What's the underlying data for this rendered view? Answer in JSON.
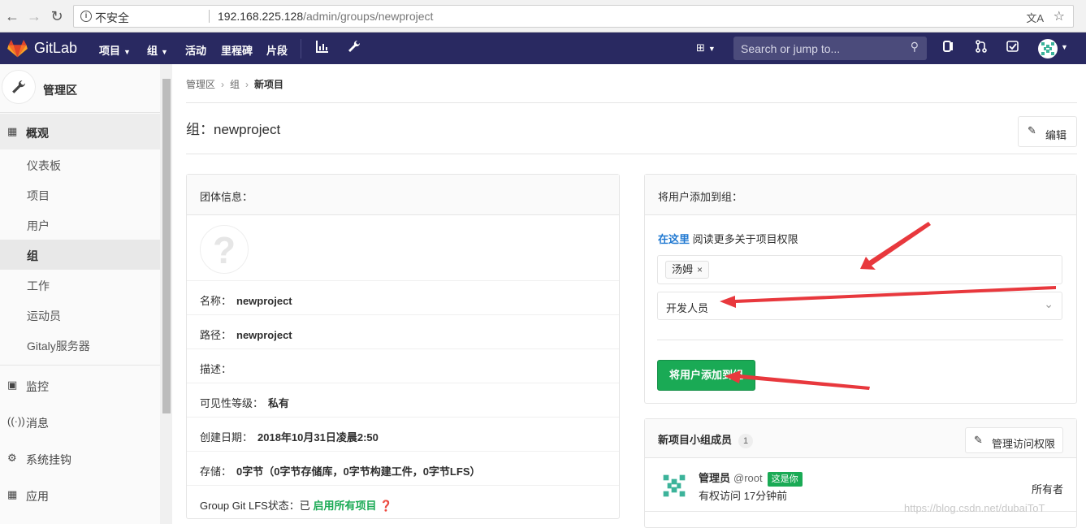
{
  "browser": {
    "insecure_label": "不安全",
    "url_host": "192.168.225.128",
    "url_path": "/admin/groups/newproject"
  },
  "navbar": {
    "brand": "GitLab",
    "menu": [
      "项目",
      "组",
      "活动",
      "里程碑",
      "片段"
    ],
    "search_placeholder": "Search or jump to..."
  },
  "sidebar": {
    "title": "管理区",
    "overview_label": "概观",
    "items": [
      "仪表板",
      "项目",
      "用户",
      "组",
      "工作",
      "运动员",
      "Gitaly服务器"
    ],
    "sections": [
      "监控",
      "消息",
      "系统挂钩",
      "应用"
    ]
  },
  "breadcrumb": {
    "items": [
      "管理区",
      "组"
    ],
    "current": "新项目"
  },
  "page": {
    "title": "组：newproject",
    "edit_label": "编辑"
  },
  "group_info": {
    "header": "团体信息：",
    "name_label": "名称：",
    "name_value": "newproject",
    "path_label": "路径：",
    "path_value": "newproject",
    "desc_label": "描述：",
    "visibility_label": "可见性等级：",
    "visibility_value": "私有",
    "created_label": "创建日期：",
    "created_value": "2018年10月31日凌晨2:50",
    "storage_label": "存储：",
    "storage_value": "0字节（0字节存储库，0字节构建工件，0字节LFS）",
    "lfs_label": "Group Git LFS状态：已",
    "lfs_value": "启用所有项目"
  },
  "add_user": {
    "header": "将用户添加到组：",
    "help_link": "在这里",
    "help_text": "阅读更多关于项目权限",
    "selected_user": "汤姆",
    "role_value": "开发人员",
    "submit_label": "将用户添加到组"
  },
  "members": {
    "title": "新项目小组成员",
    "count": "1",
    "manage_label": "管理访问权限",
    "list": [
      {
        "name": "管理员",
        "username": "@root",
        "badge": "这是你",
        "access_text": "有权访问 17分钟前",
        "role": "所有者"
      }
    ]
  },
  "watermark": "https://blog.csdn.net/dubaiToT",
  "colors": {
    "navbar": "#292961",
    "green": "#1aaa55",
    "link": "#1f78d1",
    "annotation_arrow": "#e8383d"
  }
}
